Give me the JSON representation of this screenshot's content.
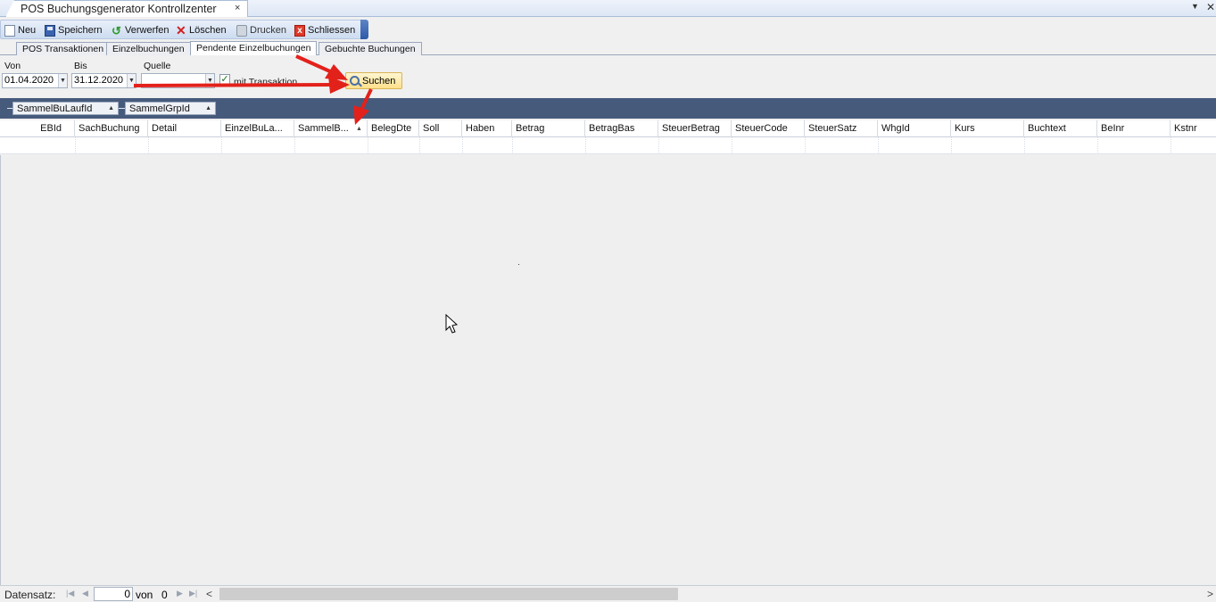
{
  "window": {
    "tab_title": "POS Buchungsgenerator Kontrollzenter",
    "tab_close": "×",
    "ctrl_down": "▼",
    "ctrl_close": "✕"
  },
  "toolbar": {
    "new_label": "Neu",
    "save_label": "Speichern",
    "discard_label": "Verwerfen",
    "delete_label": "Löschen",
    "print_label": "Drucken",
    "close_label": "Schliessen"
  },
  "tabs": [
    {
      "label": "POS Transaktionen"
    },
    {
      "label": "Einzelbuchungen"
    },
    {
      "label": "Pendente Einzelbuchungen",
      "active": true
    },
    {
      "label": "Gebuchte Buchungen"
    }
  ],
  "filters": {
    "from_label": "Von",
    "from_value": "01.04.2020",
    "to_label": "Bis",
    "to_value": "31.12.2020",
    "source_label": "Quelle",
    "source_value": "",
    "with_transaction_label": "mit Transaktion",
    "with_transaction_checked": true,
    "search_label": "Suchen"
  },
  "group_panel": {
    "chips": [
      {
        "label": "SammelBuLaufId"
      },
      {
        "label": "SammelGrpId"
      }
    ]
  },
  "grid": {
    "columns": [
      "EBId",
      "SachBuchung",
      "Detail",
      "EinzelBuLa...",
      "SammelB...",
      "BelegDte",
      "Soll",
      "Haben",
      "Betrag",
      "BetragBas",
      "SteuerBetrag",
      "SteuerCode",
      "SteuerSatz",
      "WhgId",
      "Kurs",
      "Buchtext",
      "BeInr",
      "Kstnr"
    ],
    "sorted_column": "SammelB...",
    "rows": []
  },
  "footer": {
    "record_label": "Datensatz:",
    "current_record": "0",
    "of_label": "von",
    "total_records": "0"
  },
  "colors": {
    "group_panel_bg": "#465a7c",
    "toolbar_bg": "#cddcf0",
    "search_button_bg": "#ffe08a",
    "annotation_arrow": "#e3211b"
  }
}
